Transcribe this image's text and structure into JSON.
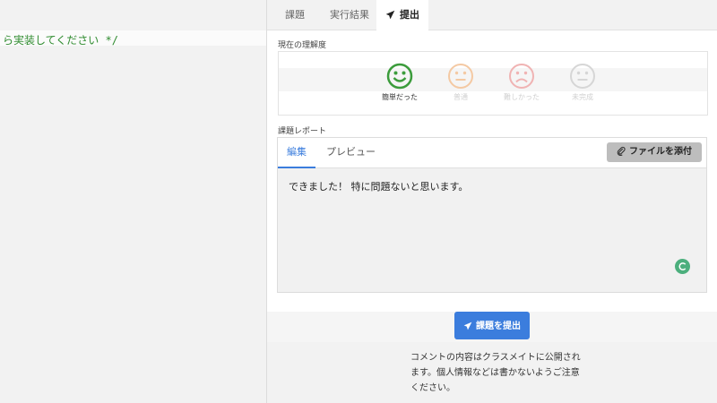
{
  "editor": {
    "code_line": "ら実装してください */"
  },
  "tabs": [
    {
      "label": "課題"
    },
    {
      "label": "実行結果"
    },
    {
      "label": "提出",
      "icon": "send-icon",
      "active": true
    }
  ],
  "understanding": {
    "label": "現在の理解度",
    "options": [
      {
        "label": "簡単だった",
        "icon": "smile-icon",
        "color": "#3c9c3c",
        "selected": true
      },
      {
        "label": "普通",
        "icon": "neutral-face-icon",
        "color": "#f4c9a3",
        "selected": false
      },
      {
        "label": "難しかった",
        "icon": "frown-icon",
        "color": "#f0b3b3",
        "selected": false
      },
      {
        "label": "未完成",
        "icon": "neutral-face-icon",
        "color": "#d6d6d6",
        "selected": false
      }
    ]
  },
  "report": {
    "label": "課題レポート",
    "tabs": [
      {
        "label": "編集",
        "active": true
      },
      {
        "label": "プレビュー",
        "active": false
      }
    ],
    "attach_label": "ファイルを添付",
    "body": "できました！ 特に問題ないと思います。"
  },
  "submit": {
    "label": "課題を提出"
  },
  "notice": "コメントの内容はクラスメイトに公開されます。個人情報などは書かないようご注意ください。",
  "colors": {
    "accent": "#3b7ddd",
    "code": "#2e8b2e",
    "success": "#3c9c3c"
  }
}
